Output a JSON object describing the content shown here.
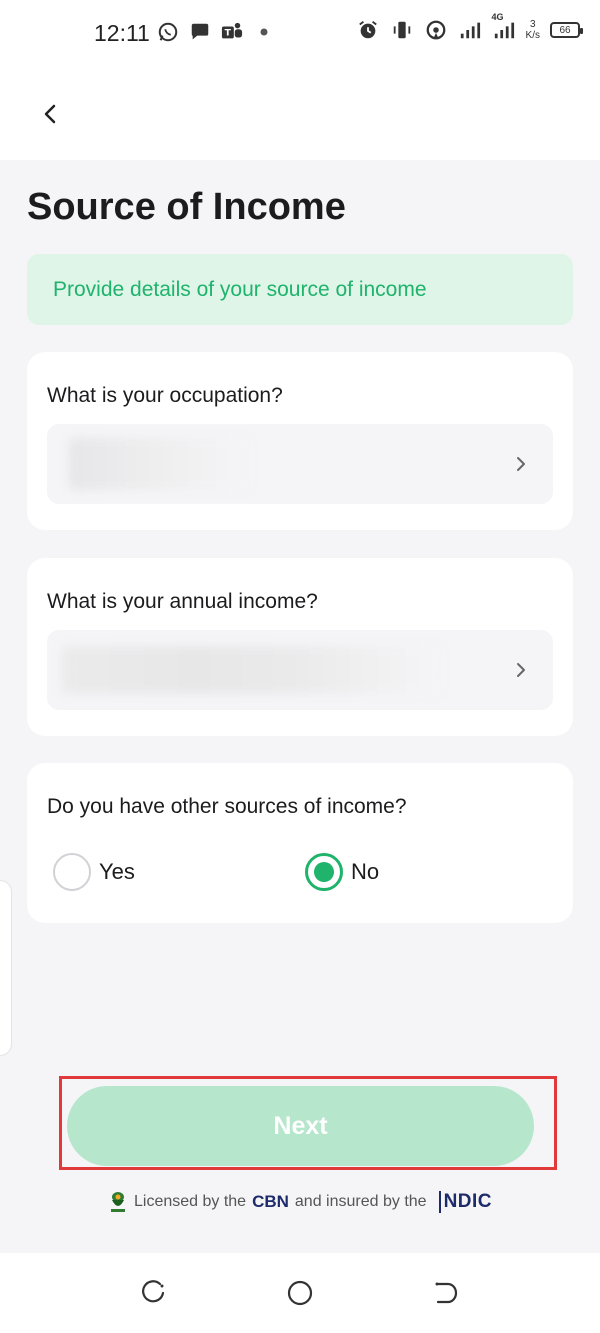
{
  "status_bar": {
    "time": "12:11",
    "network_type": "4G",
    "speed_value": "3",
    "speed_unit": "K/s",
    "battery": "66"
  },
  "header": {
    "back_icon": "chevron-left-icon"
  },
  "page": {
    "title": "Source of Income",
    "banner_text": "Provide details of your source of income"
  },
  "occupation": {
    "label": "What is your occupation?",
    "value_hidden": true
  },
  "annual_income": {
    "label": "What is your annual income?",
    "value_hidden": true
  },
  "other_sources": {
    "question": "Do you have other sources of income?",
    "options": [
      "Yes",
      "No"
    ],
    "selected": "No"
  },
  "next_button": {
    "label": "Next",
    "enabled": false
  },
  "footer": {
    "licensed_by": "Licensed by the",
    "cbn": "CBN",
    "insured_by": "and insured by the",
    "ndic": "NDIC"
  },
  "colors": {
    "accent": "#1fb36c",
    "banner_bg": "#dff5e8",
    "disabled_button": "#b6e6cc",
    "highlight": "#e0393a",
    "background": "#f5f5f7"
  }
}
